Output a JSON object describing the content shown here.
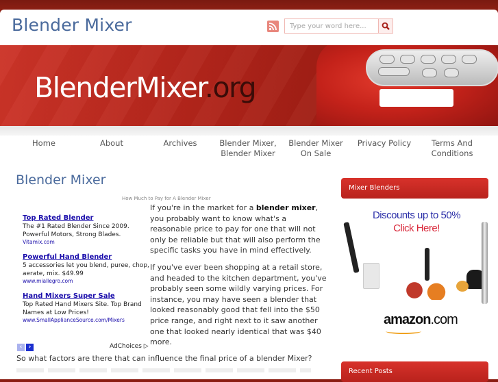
{
  "header": {
    "site_title": "Blender Mixer",
    "search_placeholder": "Type your word here...",
    "icons": [
      "rss-icon",
      "search-icon"
    ]
  },
  "banner": {
    "logo_main": "BlenderMixer",
    "logo_tld": ".org"
  },
  "nav": {
    "items": [
      {
        "label": "Home"
      },
      {
        "label": "About"
      },
      {
        "label": "Archives"
      },
      {
        "label": "Blender Mixer, Blender Mixer"
      },
      {
        "label": "Blender Mixer On Sale"
      },
      {
        "label": "Privacy Policy"
      },
      {
        "label": "Terms And Conditions"
      }
    ]
  },
  "main": {
    "title": "Blender Mixer",
    "image_caption": "How Much to Pay for A Blender Mixer",
    "paragraph1_pre": "If you're in the market for a ",
    "paragraph1_bold": "blender mixer",
    "paragraph1_post": ", you probably want to know what's a reasonable price to pay for one that will not only be reliable but that will also perform the specific tasks you have in mind effectively.",
    "paragraph2": "If you've ever been shopping at a retail store, and headed to the kitchen department, you've probably seen some wildly varying prices. For instance, you may have seen a blender that looked reasonably good that fell into the $50 price range, and right next to it saw another one that looked nearly identical that was $40 more.",
    "paragraph3": "So what factors are there that can influence the final price of a blender Mixer?"
  },
  "ads": {
    "items": [
      {
        "title": "Top Rated Blender",
        "text": "The #1 Rated Blender Since 2009. Powerful Motors, Strong Blades.",
        "url": "Vitamix.com"
      },
      {
        "title": "Powerful Hand Blender",
        "text": "5 accessories let you blend, puree, chop, aerate, mix. $49.99",
        "url": "www.miallegro.com"
      },
      {
        "title": "Hand Mixers Super Sale",
        "text": "Top Rated Hand Mixers Site. Top Brand Names at Low Prices!",
        "url": "www.SmallApplianceSource.com/Mixers"
      }
    ],
    "prev_label": "‹",
    "next_label": "›",
    "adchoices_label": "AdChoices ▷"
  },
  "sidebar": {
    "widget1_title": "Mixer Blenders",
    "promo_line1": "Discounts up to 50%",
    "promo_line2": "Click Here!",
    "promo_brand": "amazon",
    "promo_brand_suffix": ".com",
    "widget2_title": "Recent Posts",
    "colors": {
      "promo_line1": "#2b2fa8",
      "promo_line2": "#d9283a"
    }
  }
}
